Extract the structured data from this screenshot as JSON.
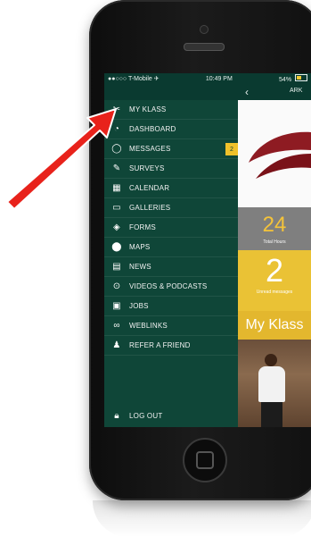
{
  "status_bar": {
    "carrier": "●●○○○ T-Mobile ✈︎",
    "time": "10:49 PM",
    "battery": "54%",
    "battery_level": 0.54
  },
  "navbar": {
    "back_icon": "chevron-left-icon",
    "title": "ARK"
  },
  "menu": {
    "items": [
      {
        "label": "MY KLASS",
        "icon": "tools-icon"
      },
      {
        "label": "DASHBOARD",
        "icon": "gauge-icon"
      },
      {
        "label": "MESSAGES",
        "icon": "chat-icon",
        "badge": "2"
      },
      {
        "label": "SURVEYS",
        "icon": "pencil-icon"
      },
      {
        "label": "CALENDAR",
        "icon": "calendar-icon"
      },
      {
        "label": "GALLERIES",
        "icon": "gallery-icon"
      },
      {
        "label": "FORMS",
        "icon": "layers-icon"
      },
      {
        "label": "MAPS",
        "icon": "map-pin-icon"
      },
      {
        "label": "NEWS",
        "icon": "newspaper-icon"
      },
      {
        "label": "VIDEOS & PODCASTS",
        "icon": "play-circle-icon"
      },
      {
        "label": "JOBS",
        "icon": "briefcase-icon"
      },
      {
        "label": "WEBLINKS",
        "icon": "link-icon"
      },
      {
        "label": "REFER A FRIEND",
        "icon": "users-icon"
      }
    ],
    "logout": {
      "label": "LOG OUT",
      "icon": "lock-icon"
    }
  },
  "content": {
    "hours": {
      "value": "24",
      "label": "Total Hours"
    },
    "messages": {
      "value": "2",
      "label": "Unread messages"
    },
    "section_title": "My Klass"
  },
  "colors": {
    "menu_bg": "#0f4638",
    "accent_yellow": "#eac235",
    "arrow_red": "#e8221b"
  }
}
